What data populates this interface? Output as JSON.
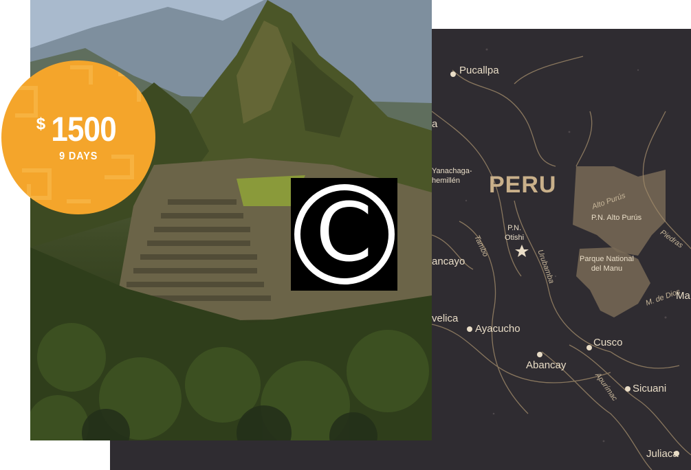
{
  "price_badge": {
    "currency": "$",
    "amount": "1500",
    "duration": "9 DAYS",
    "color": "#f4a52b"
  },
  "copyright_badge": {
    "symbol": "C",
    "icon": "copyright-icon"
  },
  "map": {
    "country": "PERU",
    "cities": [
      "Pucallpa",
      "Ayacucho",
      "Cusco",
      "Abancay",
      "Sicuani",
      "Juliaca"
    ],
    "partial_cities": [
      "a",
      "ancayo",
      "velica",
      "Ma"
    ],
    "parks": {
      "yanachaga_line1": "Yanachaga-",
      "yanachaga_line2": "hemillén",
      "otishi_line1": "P.N.",
      "otishi_line2": "Otishi",
      "alto_purus": "P.N. Alto Purús",
      "manu_line1": "Parque National",
      "manu_line2": "del Manu"
    },
    "rivers": {
      "alto_purus": "Alto Purús",
      "tambo": "Tambo",
      "urubamba": "Urubamba",
      "piedras": "Piedras",
      "madre_de_dios": "M. de Dios",
      "apurimac": "Apurímac"
    },
    "colors": {
      "background": "#2f2c31",
      "highlight": "#786a56",
      "lines": "#a08a6a"
    }
  }
}
